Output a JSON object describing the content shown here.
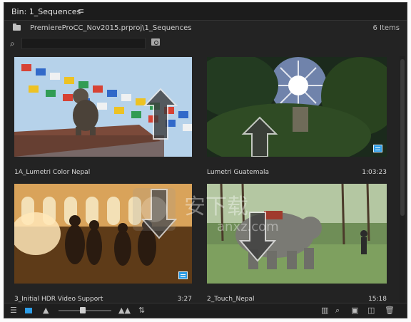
{
  "panel": {
    "title": "Bin: 1_Sequences",
    "menu_icon": "hamburger-menu-icon",
    "path": "PremiereProCC_Nov2015.prproj\\1_Sequences",
    "item_count": "6 Items"
  },
  "search": {
    "placeholder": "",
    "value": ""
  },
  "clips": [
    {
      "name": "1A_Lumetri Color Nepal",
      "duration": ""
    },
    {
      "name": "Lumetri Guatemala",
      "duration": "1:03:23"
    },
    {
      "name": "3_Initial HDR Video Support",
      "duration": "3:27"
    },
    {
      "name": "2_Touch_Nepal",
      "duration": "15:18"
    }
  ],
  "watermark": {
    "line1": "安下载",
    "line2": "anxz.com"
  },
  "colors": {
    "accent": "#2d9de7",
    "panel_bg": "#232323"
  }
}
